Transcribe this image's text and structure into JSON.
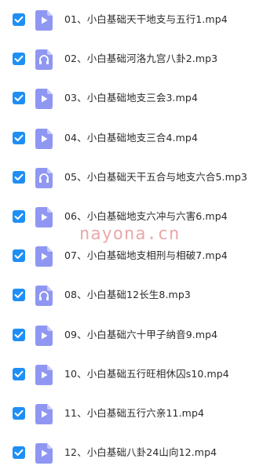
{
  "colors": {
    "checkbox": "#1f8ff5",
    "icon_fill": "#8f97f2",
    "icon_fold": "#c6cbfa",
    "text": "#2a2a2a",
    "watermark": "#e8a0a0"
  },
  "watermark": "nayona.cn",
  "files": [
    {
      "name": "01、小白基础天干地支与五行1.mp4",
      "type": "video",
      "icon": "play-icon",
      "checked": true
    },
    {
      "name": "02、小白基础河洛九宫八卦2.mp3",
      "type": "audio",
      "icon": "headphones-icon",
      "checked": true
    },
    {
      "name": "03、小白基础地支三会3.mp4",
      "type": "video",
      "icon": "play-icon",
      "checked": true
    },
    {
      "name": "04、小白基础地支三合4.mp4",
      "type": "video",
      "icon": "play-icon",
      "checked": true
    },
    {
      "name": "05、小白基础天干五合与地支六合5.mp3",
      "type": "audio",
      "icon": "headphones-icon",
      "checked": true
    },
    {
      "name": "06、小白基础地支六冲与六害6.mp4",
      "type": "video",
      "icon": "play-icon",
      "checked": true
    },
    {
      "name": "07、小白基础地支相刑与相破7.mp4",
      "type": "video",
      "icon": "play-icon",
      "checked": true
    },
    {
      "name": "08、小白基础12长生8.mp3",
      "type": "audio",
      "icon": "headphones-icon",
      "checked": true
    },
    {
      "name": "09、小白基础六十甲子纳音9.mp4",
      "type": "video",
      "icon": "play-icon",
      "checked": true
    },
    {
      "name": "10、小白基础五行旺相休囚s10.mp4",
      "type": "video",
      "icon": "play-icon",
      "checked": true
    },
    {
      "name": "11、小白基础五行六亲11.mp4",
      "type": "video",
      "icon": "play-icon",
      "checked": true
    },
    {
      "name": "12、小白基础八卦24山向12.mp4",
      "type": "video",
      "icon": "play-icon",
      "checked": true
    }
  ]
}
